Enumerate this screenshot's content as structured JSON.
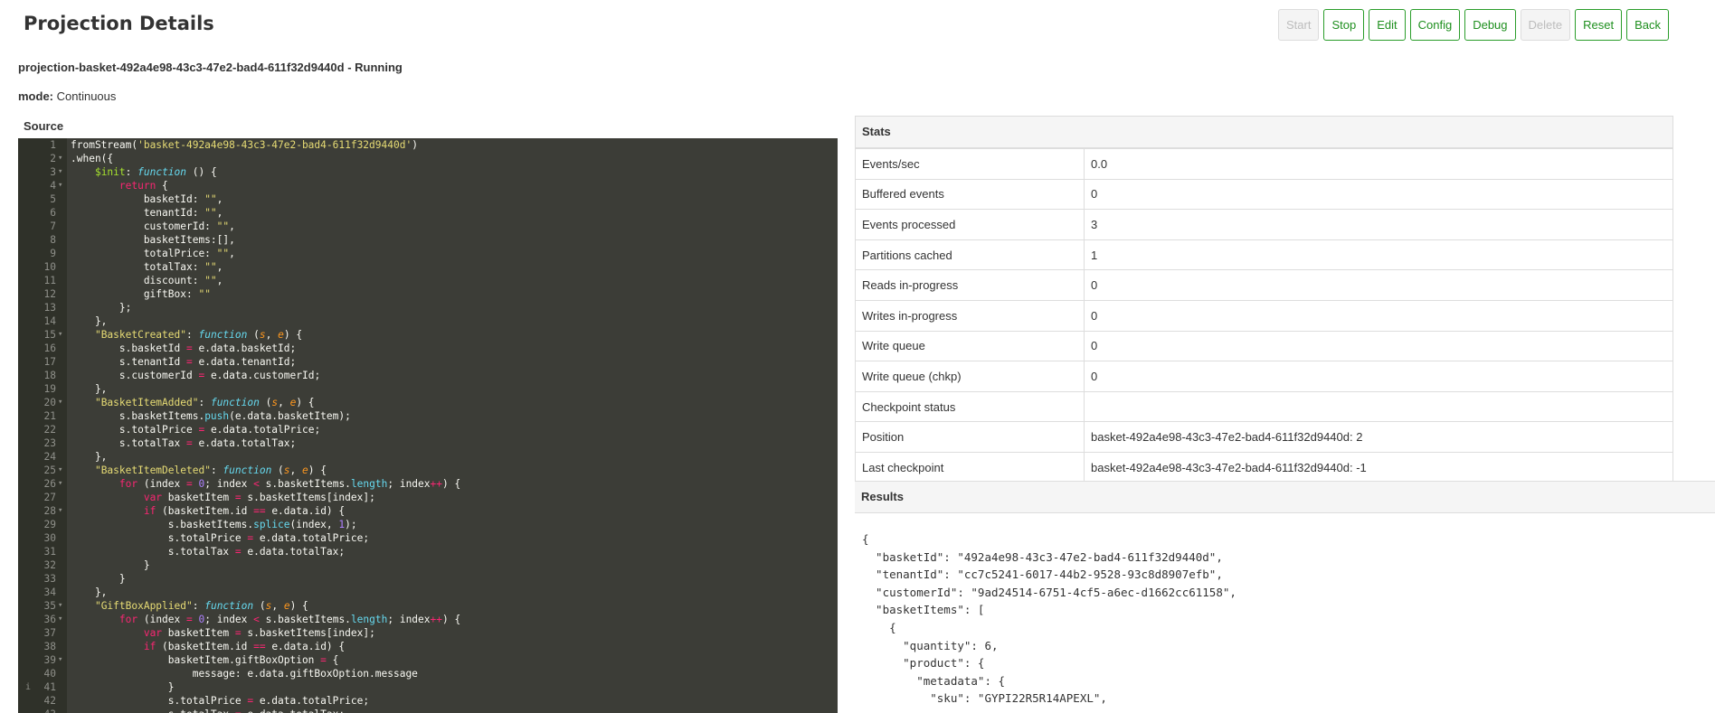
{
  "page": {
    "title": "Projection Details"
  },
  "toolbar": {
    "buttons": [
      {
        "label": "Start",
        "enabled": false
      },
      {
        "label": "Stop",
        "enabled": true
      },
      {
        "label": "Edit",
        "enabled": true
      },
      {
        "label": "Config",
        "enabled": true
      },
      {
        "label": "Debug",
        "enabled": true
      },
      {
        "label": "Delete",
        "enabled": false
      },
      {
        "label": "Reset",
        "enabled": true
      },
      {
        "label": "Back",
        "enabled": true
      }
    ]
  },
  "projection": {
    "name_status": "projection-basket-492a4e98-43c3-47e2-bad4-611f32d9440d - Running",
    "mode_label": "mode:",
    "mode_value": "Continuous"
  },
  "source": {
    "label": "Source",
    "lines": [
      "fromStream('basket-492a4e98-43c3-47e2-bad4-611f32d9440d')",
      ".when({",
      "    $init: function () {",
      "        return {",
      "            basketId: \"\",",
      "            tenantId: \"\",",
      "            customerId: \"\",",
      "            basketItems:[],",
      "            totalPrice: \"\",",
      "            totalTax: \"\",",
      "            discount: \"\",",
      "            giftBox: \"\"",
      "        };",
      "    },",
      "    \"BasketCreated\": function (s, e) {",
      "        s.basketId = e.data.basketId;",
      "        s.tenantId = e.data.tenantId;",
      "        s.customerId = e.data.customerId;",
      "    },",
      "    \"BasketItemAdded\": function (s, e) {",
      "        s.basketItems.push(e.data.basketItem);",
      "        s.totalPrice = e.data.totalPrice;",
      "        s.totalTax = e.data.totalTax;",
      "    },",
      "    \"BasketItemDeleted\": function (s, e) {",
      "        for (index = 0; index < s.basketItems.length; index++) {",
      "            var basketItem = s.basketItems[index];",
      "            if (basketItem.id == e.data.id) {",
      "                s.basketItems.splice(index, 1);",
      "                s.totalPrice = e.data.totalPrice;",
      "                s.totalTax = e.data.totalTax;",
      "            }",
      "        }",
      "    },",
      "    \"GiftBoxApplied\": function (s, e) {",
      "        for (index = 0; index < s.basketItems.length; index++) {",
      "            var basketItem = s.basketItems[index];",
      "            if (basketItem.id == e.data.id) {",
      "                basketItem.giftBoxOption = {",
      "                    message: e.data.giftBoxOption.message",
      "                }",
      "                s.totalPrice = e.data.totalPrice;",
      "                s.totalTax = e.data.totalTax;"
    ],
    "fold_lines": [
      2,
      3,
      4,
      15,
      20,
      25,
      26,
      28,
      35,
      36,
      39
    ],
    "info_lines": [
      41
    ]
  },
  "stats": {
    "title": "Stats",
    "rows": [
      {
        "label": "Events/sec",
        "value": "0.0"
      },
      {
        "label": "Buffered events",
        "value": "0"
      },
      {
        "label": "Events processed",
        "value": "3"
      },
      {
        "label": "Partitions cached",
        "value": "1"
      },
      {
        "label": "Reads in-progress",
        "value": "0"
      },
      {
        "label": "Writes in-progress",
        "value": "0"
      },
      {
        "label": "Write queue",
        "value": "0"
      },
      {
        "label": "Write queue (chkp)",
        "value": "0"
      },
      {
        "label": "Checkpoint status",
        "value": ""
      },
      {
        "label": "Position",
        "value": "basket-492a4e98-43c3-47e2-bad4-611f32d9440d: 2"
      },
      {
        "label": "Last checkpoint",
        "value": "basket-492a4e98-43c3-47e2-bad4-611f32d9440d: -1"
      }
    ]
  },
  "results": {
    "title": "Results",
    "lines": [
      "{",
      "  \"basketId\": \"492a4e98-43c3-47e2-bad4-611f32d9440d\",",
      "  \"tenantId\": \"cc7c5241-6017-44b2-9528-93c8d8907efb\",",
      "  \"customerId\": \"9ad24514-6751-4cf5-a6ec-d1662cc61158\",",
      "  \"basketItems\": [",
      "    {",
      "      \"quantity\": 6,",
      "      \"product\": {",
      "        \"metadata\": {",
      "          \"sku\": \"GYPI22R5R14APEXL\","
    ]
  }
}
